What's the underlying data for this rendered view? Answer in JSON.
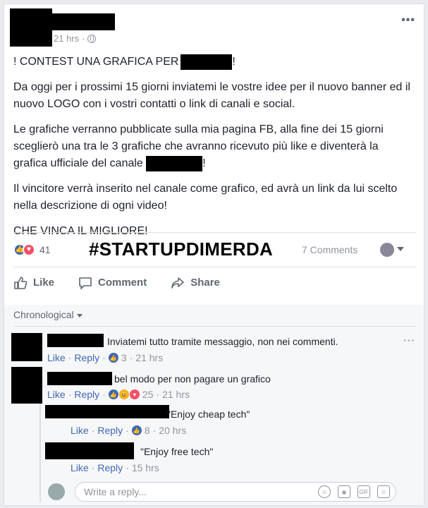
{
  "post": {
    "timestamp": "21 hrs",
    "paragraphs": {
      "p1_a": "! CONTEST UNA GRAFICA PER",
      "p1_b": "!",
      "p2": "Da oggi per i prossimi 15 giorni inviatemi le vostre idee per il nuovo banner ed il nuovo LOGO con i vostri contatti o link di canali e social.",
      "p3_a": "Le grafiche verranno pubblicate sulla mia pagina FB, alla fine dei 15 giorni sceglierò una tra le 3 grafiche che avranno ricevuto più like e diventerà la grafica ufficiale del canale",
      "p3_b": "!",
      "p4": "Il vincitore verrà inserito nel canale come grafico, ed avrà un link da lui scelto nella descrizione di ogni video!",
      "p5": "CHE VINCA IL MIGLIORE!"
    },
    "overlay_hashtag": "#STARTUPDIMERDA",
    "reaction_count": "41",
    "comments_count": "7 Comments",
    "more_icon": "more-horizontal-icon"
  },
  "actions": {
    "like": "Like",
    "comment": "Comment",
    "share": "Share"
  },
  "comments": {
    "sort_label": "Chronological",
    "items": [
      {
        "text": "Inviatemi tutto tramite messaggio, non nei commenti.",
        "like": "Like",
        "reply": "Reply",
        "reactions": "3",
        "time": "21 hrs"
      },
      {
        "text": "bel modo per non pagare un grafico",
        "like": "Like",
        "reply": "Reply",
        "reactions": "25",
        "time": "21 hrs"
      }
    ],
    "replies": [
      {
        "text": "\"Enjoy cheap tech\"",
        "like": "Like",
        "reply": "Reply",
        "reactions": "8",
        "time": "20 hrs"
      },
      {
        "text": "\"Enjoy free tech\"",
        "like": "Like",
        "reply": "Reply",
        "time": "15 hrs"
      }
    ],
    "reply_placeholder": "Write a reply..."
  },
  "colors": {
    "link": "#4267b2",
    "meta": "#90949c",
    "background": "#e9ebee"
  }
}
